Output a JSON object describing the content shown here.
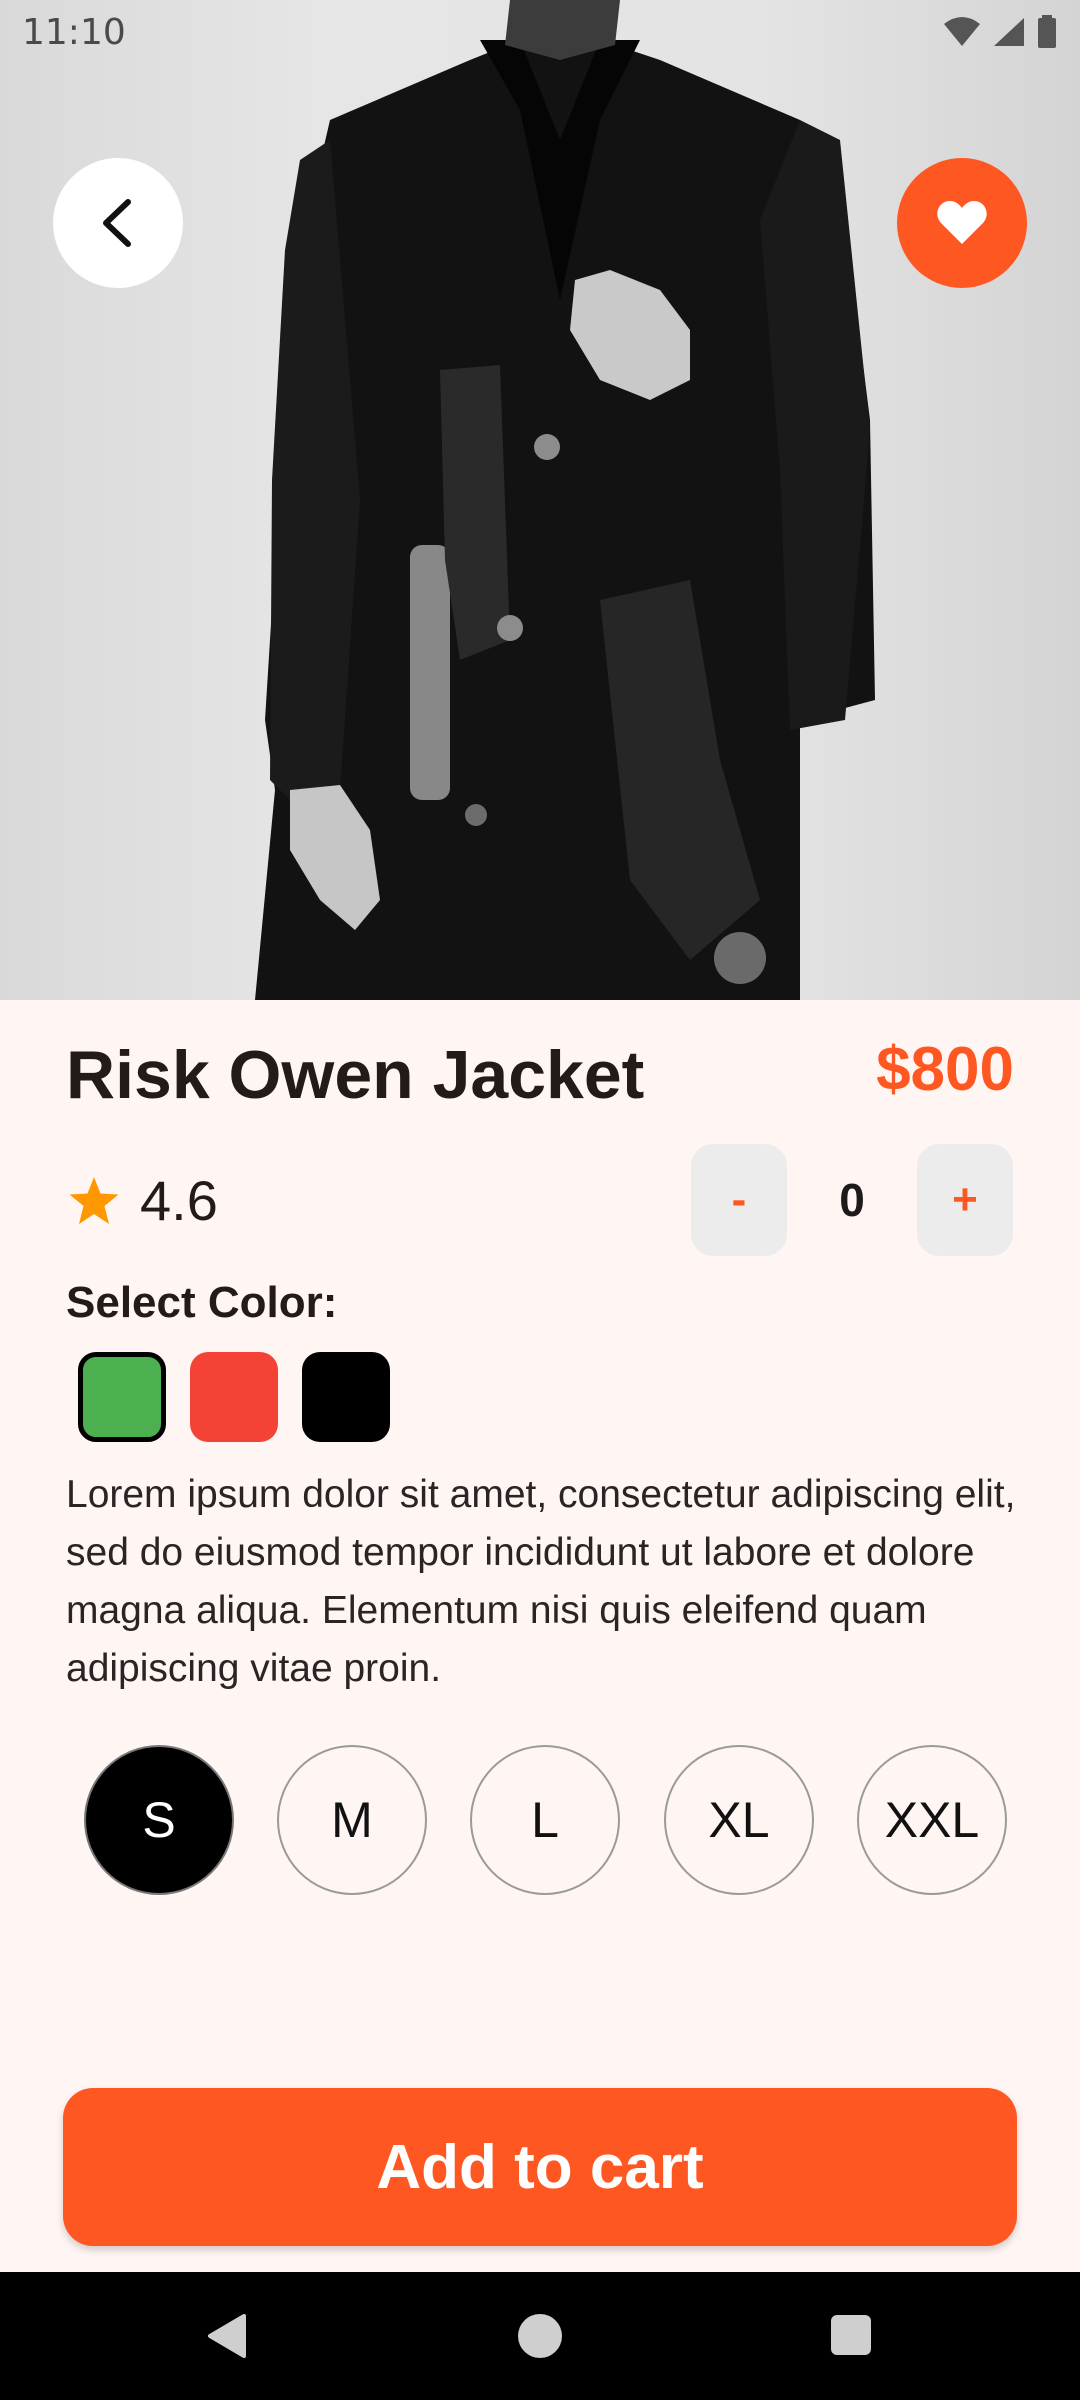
{
  "status_bar": {
    "time": "11:10",
    "icons": [
      "wifi-icon",
      "signal-icon",
      "battery-icon"
    ]
  },
  "hero": {
    "image": "product-photo-coat"
  },
  "product": {
    "title": "Risk Owen Jacket",
    "price": "$800",
    "rating": "4.6",
    "description": "Lorem ipsum dolor sit amet, consectetur adipiscing elit, sed do eiusmod tempor incididunt ut labore et dolore magna aliqua. Elementum nisi quis eleifend quam adipiscing vitae proin."
  },
  "quantity": {
    "minus_label": "-",
    "value": "0",
    "plus_label": "+"
  },
  "colors": {
    "label": "Select Color:",
    "options": [
      {
        "name": "green",
        "hex": "#4CAF50",
        "selected": true
      },
      {
        "name": "red",
        "hex": "#F44336",
        "selected": false
      },
      {
        "name": "black",
        "hex": "#000000",
        "selected": false
      }
    ]
  },
  "sizes": {
    "options": [
      "S",
      "M",
      "L",
      "XL",
      "XXL"
    ],
    "selected": "S"
  },
  "cart_button": {
    "label": "Add to cart"
  },
  "theme": {
    "accent": "#FF5722",
    "background": "#FFF6F4",
    "star": "#FF9800"
  },
  "nav_bar": {
    "icons": [
      "back-triangle-icon",
      "home-circle-icon",
      "recents-square-icon"
    ]
  }
}
